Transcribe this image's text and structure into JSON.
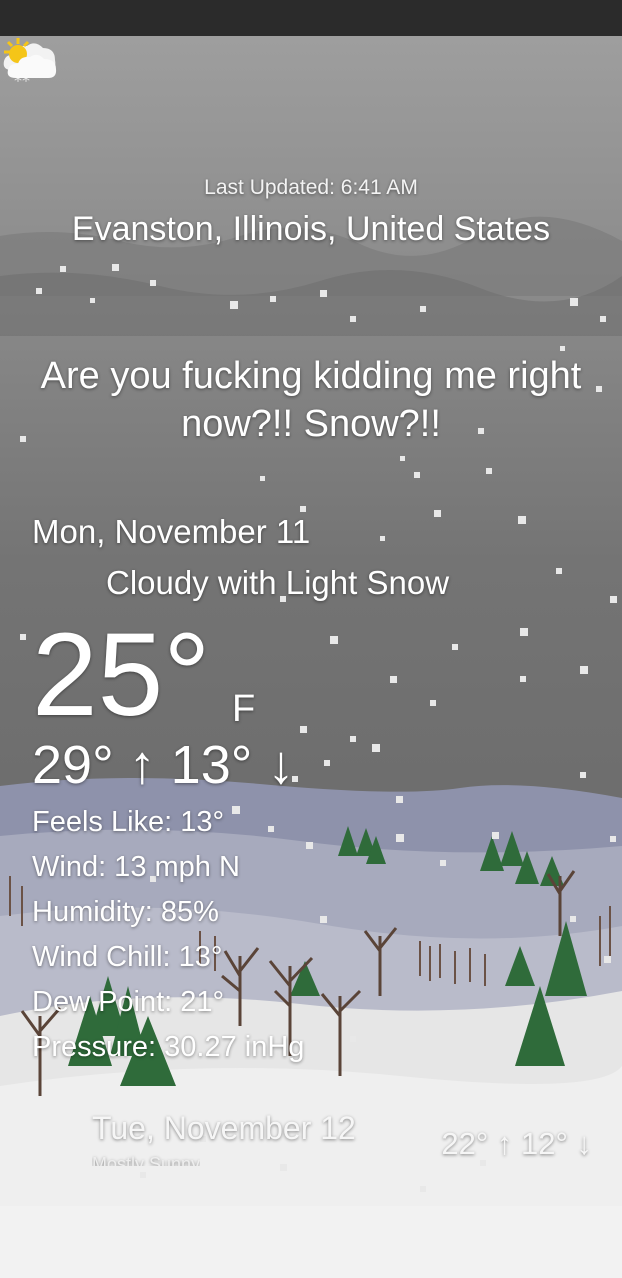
{
  "header": {
    "last_updated": "Last Updated: 6:41 AM",
    "location": "Evanston, Illinois, United States"
  },
  "headline": "Are you fucking kidding me right now?!! Snow?!!",
  "today": {
    "date": "Mon, November 11",
    "condition": "Cloudy with Light Snow",
    "condition_icon": "cloud-snow-icon",
    "temperature": "25°",
    "unit": "F",
    "hi_lo": "29° ↑ 13° ↓",
    "details": {
      "feels_like": "Feels Like: 13°",
      "wind": "Wind: 13 mph N",
      "humidity": "Humidity: 85%",
      "wind_chill": "Wind Chill: 13°",
      "dew_point": "Dew Point: 21°",
      "pressure": "Pressure: 30.27 inHg"
    }
  },
  "forecast": [
    {
      "date": "Tue, November 12",
      "condition": "Mostly Sunny",
      "condition_icon": "partly-sunny-icon",
      "hi_lo": "22° ↑ 12° ↓"
    }
  ],
  "colors": {
    "sky_top": "#9a9a9a",
    "sky_bottom": "#6e6e6e",
    "hills": "#8e92ab",
    "snow": "#ececec",
    "pine": "#2f6b3a",
    "status_bar": "#2b2b2b",
    "nav_bar": "#f2f2f2"
  }
}
